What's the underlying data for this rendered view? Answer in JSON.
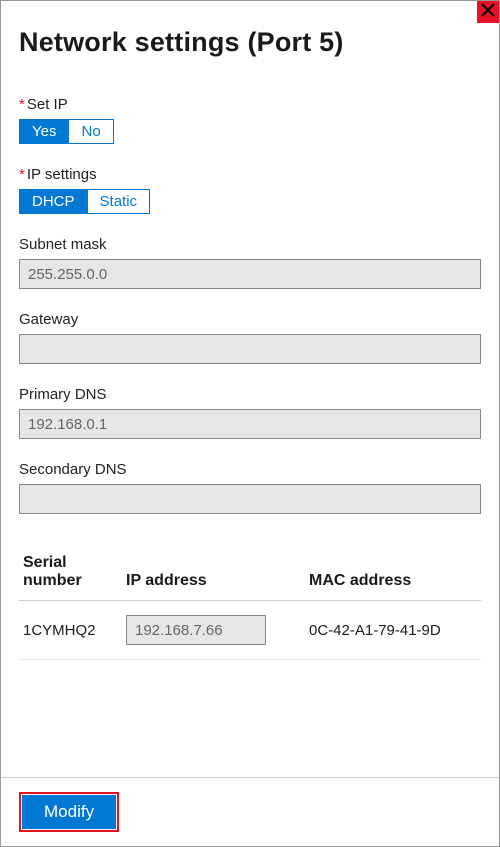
{
  "title": "Network settings (Port 5)",
  "fields": {
    "set_ip": {
      "label": "Set IP",
      "required": true,
      "options": {
        "yes": "Yes",
        "no": "No"
      },
      "selected": "yes"
    },
    "ip_settings": {
      "label": "IP settings",
      "required": true,
      "options": {
        "dhcp": "DHCP",
        "static": "Static"
      },
      "selected": "dhcp"
    },
    "subnet_mask": {
      "label": "Subnet mask",
      "value": "255.255.0.0"
    },
    "gateway": {
      "label": "Gateway",
      "value": ""
    },
    "primary_dns": {
      "label": "Primary DNS",
      "value": "192.168.0.1"
    },
    "secondary_dns": {
      "label": "Secondary DNS",
      "value": ""
    }
  },
  "table": {
    "headers": {
      "serial": "Serial number",
      "ip": "IP address",
      "mac": "MAC address"
    },
    "rows": [
      {
        "serial": "1CYMHQ2",
        "ip": "192.168.7.66",
        "mac": "0C-42-A1-79-41-9D"
      }
    ]
  },
  "footer": {
    "modify": "Modify"
  },
  "required_marker": "*"
}
